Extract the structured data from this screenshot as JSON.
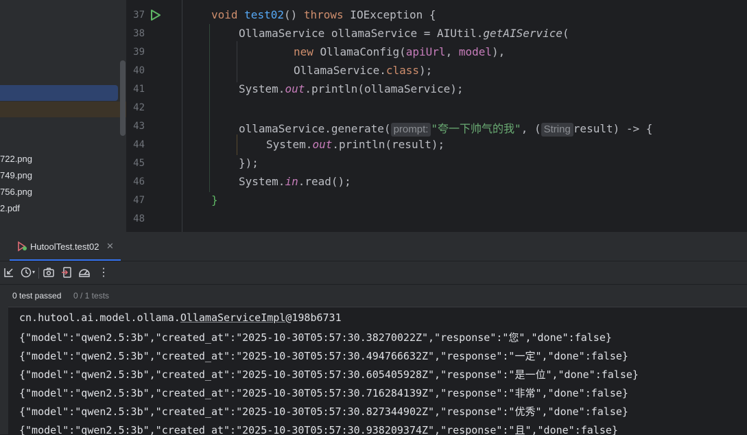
{
  "project_tree": {
    "files": [
      "722.png",
      "749.png",
      "756.png",
      "2.pdf"
    ]
  },
  "editor": {
    "line_numbers": [
      "37",
      "38",
      "39",
      "40",
      "41",
      "42",
      "43",
      "44",
      "45",
      "46",
      "47",
      "48"
    ],
    "l37": {
      "kw1": "void",
      "method": "test02",
      "rest": "() ",
      "kw2": "throws",
      "exc": " IOException {"
    },
    "l38": {
      "a": "OllamaService ollamaService = AIUtil.",
      "m": "getAIService",
      "b": "("
    },
    "l39": {
      "kw": "new",
      "a": " OllamaConfig(",
      "f1": "apiUrl",
      "c": ", ",
      "f2": "model",
      "b": "),"
    },
    "l40": {
      "a": "OllamaService.",
      "f": "class",
      "b": ");"
    },
    "l41": {
      "a": "System.",
      "f": "out",
      "b": ".println(ollamaService);"
    },
    "l43": {
      "a": "ollamaService.generate(",
      "hint1": "prompt:",
      "s": "\"夸一下帅气的我\"",
      "c": ", (",
      "hint2": "String",
      "b": "result) -> {"
    },
    "l44": {
      "a": "System.",
      "f": "out",
      "b": ".println(result);"
    },
    "l45": {
      "a": "});"
    },
    "l46": {
      "a": "System.",
      "f": "in",
      "b": ".read();"
    },
    "l47": {
      "a": "}"
    }
  },
  "run": {
    "tab_label": "HutoolTest.test02",
    "passed": "0 test passed",
    "count": "0 / 1 tests",
    "console_first_prefix": "cn.hutool.ai.model.ollama.",
    "console_first_link": "OllamaServiceImpl",
    "console_first_suffix": "@198b6731",
    "console_lines": [
      "{\"model\":\"qwen2.5:3b\",\"created_at\":\"2025-10-30T05:57:30.38270022Z\",\"response\":\"您\",\"done\":false}",
      "{\"model\":\"qwen2.5:3b\",\"created_at\":\"2025-10-30T05:57:30.494766632Z\",\"response\":\"一定\",\"done\":false}",
      "{\"model\":\"qwen2.5:3b\",\"created_at\":\"2025-10-30T05:57:30.605405928Z\",\"response\":\"是一位\",\"done\":false}",
      "{\"model\":\"qwen2.5:3b\",\"created_at\":\"2025-10-30T05:57:30.716284139Z\",\"response\":\"非常\",\"done\":false}",
      "{\"model\":\"qwen2.5:3b\",\"created_at\":\"2025-10-30T05:57:30.827344902Z\",\"response\":\"优秀\",\"done\":false}",
      "{\"model\":\"qwen2.5:3b\",\"created_at\":\"2025-10-30T05:57:30.938209374Z\",\"response\":\"且\",\"done\":false}"
    ]
  },
  "icons": {
    "run_gutter": "play-icon",
    "tab": "test-icon",
    "toolbar": [
      "import-tests-icon",
      "history-icon",
      "screenshot-icon",
      "export-icon",
      "coverage-icon",
      "more-icon"
    ]
  },
  "colors": {
    "accent": "#3574f0",
    "keyword": "#cf8e6d",
    "string": "#6aab73",
    "function": "#56a8f5",
    "field": "#c77dbb"
  }
}
